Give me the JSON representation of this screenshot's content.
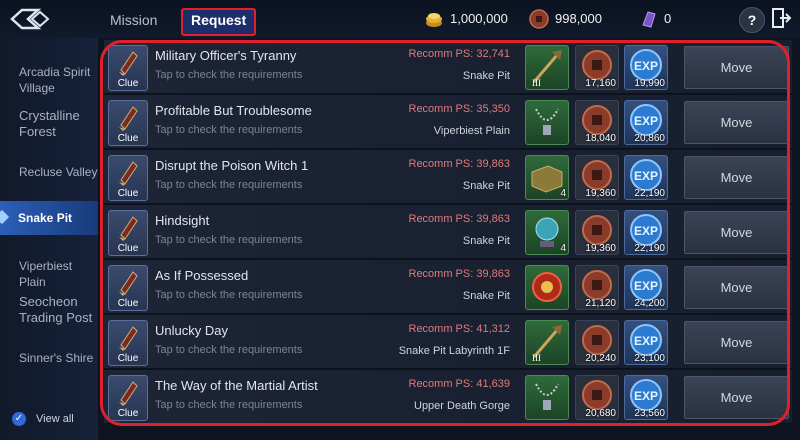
{
  "header": {
    "tabs": [
      {
        "label": "Mission"
      },
      {
        "label": "Request"
      }
    ],
    "gold": "1,000,000",
    "coins": "998,000",
    "crystals": "0",
    "help": "?"
  },
  "sidebar": {
    "items": [
      {
        "label": "Arcadia Spirit Village"
      },
      {
        "label": "Crystalline Forest"
      },
      {
        "label": "Recluse Valley"
      },
      {
        "label": "Snake Pit"
      },
      {
        "label": "Viperbiest Plain"
      },
      {
        "label": "Seocheon Trading Post"
      },
      {
        "label": "Sinner's Shire"
      }
    ],
    "view_all": "View all"
  },
  "quests": [
    {
      "clue": "Clue",
      "title": "Military Officer's Tyranny",
      "sub": "Tap to check the requirements",
      "ps": "Recomm PS: 32,741",
      "loc": "Snake Pit",
      "item_icon": "staff-icon",
      "item_count": "",
      "coin": "17,160",
      "exp": "19,990",
      "move": "Move"
    },
    {
      "clue": "Clue",
      "title": "Profitable But Troublesome",
      "sub": "Tap to check the requirements",
      "ps": "Recomm PS: 35,350",
      "loc": "Viperbiest Plain",
      "item_icon": "necklace-icon",
      "item_count": "",
      "coin": "18,040",
      "exp": "20,860",
      "move": "Move"
    },
    {
      "clue": "Clue",
      "title": "Disrupt the Poison Witch 1",
      "sub": "Tap to check the requirements",
      "ps": "Recomm PS: 39,863",
      "loc": "Snake Pit",
      "item_icon": "box-icon",
      "item_count": "4",
      "coin": "19,360",
      "exp": "22,190",
      "move": "Move"
    },
    {
      "clue": "Clue",
      "title": "Hindsight",
      "sub": "Tap to check the requirements",
      "ps": "Recomm PS: 39,863",
      "loc": "Snake Pit",
      "item_icon": "orb-icon",
      "item_count": "4",
      "coin": "19,360",
      "exp": "22,190",
      "move": "Move"
    },
    {
      "clue": "Clue",
      "title": "As If Possessed",
      "sub": "Tap to check the requirements",
      "ps": "Recomm PS: 39,863",
      "loc": "Snake Pit",
      "item_icon": "gem-icon",
      "item_count": "",
      "coin": "21,120",
      "exp": "24,200",
      "move": "Move"
    },
    {
      "clue": "Clue",
      "title": "Unlucky Day",
      "sub": "Tap to check the requirements",
      "ps": "Recomm PS: 41,312",
      "loc": "Snake Pit Labyrinth 1F",
      "item_icon": "staff-icon",
      "item_count": "",
      "coin": "20,240",
      "exp": "23,100",
      "move": "Move"
    },
    {
      "clue": "Clue",
      "title": "The Way of the Martial Artist",
      "sub": "Tap to check the requirements",
      "ps": "Recomm PS: 41,639",
      "loc": "Upper Death Gorge",
      "item_icon": "necklace-icon",
      "item_count": "",
      "coin": "20,680",
      "exp": "23,560",
      "move": "Move"
    }
  ],
  "colors": {
    "accent": "#e0202a",
    "active_tab": "#1d2f6a",
    "sidebar_active": "#2b5fb8"
  }
}
